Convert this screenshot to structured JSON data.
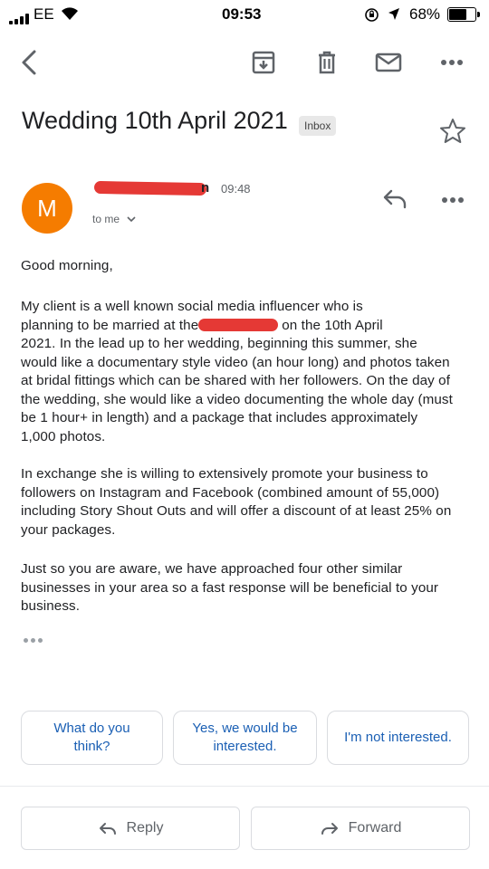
{
  "status_bar": {
    "carrier": "EE",
    "time": "09:53",
    "battery": "68%"
  },
  "email": {
    "subject": "Wedding 10th April 2021",
    "label": "Inbox",
    "sender": {
      "avatar_letter": "M",
      "name_visible_end": "n",
      "time": "09:48",
      "recipient": "to me"
    },
    "greeting": "Good morning,",
    "paragraph1": {
      "line1": "My client is a well known social media influencer who is",
      "line2_before": "planning to be married at the",
      "line2_after": "on the 10th April",
      "rest": "2021. In the lead up to her wedding, beginning this summer, she would like a documentary style video (an hour long) and photos taken at bridal fittings which can be shared with her followers. On the day of the wedding, she would like a video documenting the whole day (must be 1 hour+ in length) and a package that includes approximately 1,000 photos."
    },
    "paragraph2": "In exchange she is willing to extensively promote your business to followers on Instagram and Facebook (combined amount of 55,000) including Story Shout Outs and will offer a discount of at least 25% on your packages.",
    "paragraph3": "Just so you are aware, we have approached four other similar businesses in your area so a fast response will be beneficial to your business."
  },
  "smart_replies": [
    "What do you think?",
    "Yes, we would be interested.",
    "I'm not interested."
  ],
  "actions": {
    "reply": "Reply",
    "forward": "Forward"
  },
  "colors": {
    "avatar": "#f57c00",
    "redaction": "#e53935",
    "chip_text": "#1a5fb4"
  },
  "icons": [
    "back-arrow-icon",
    "archive-icon",
    "delete-icon",
    "mark-unread-icon",
    "more-vert-icon",
    "star-icon",
    "reply-icon",
    "forward-icon"
  ]
}
